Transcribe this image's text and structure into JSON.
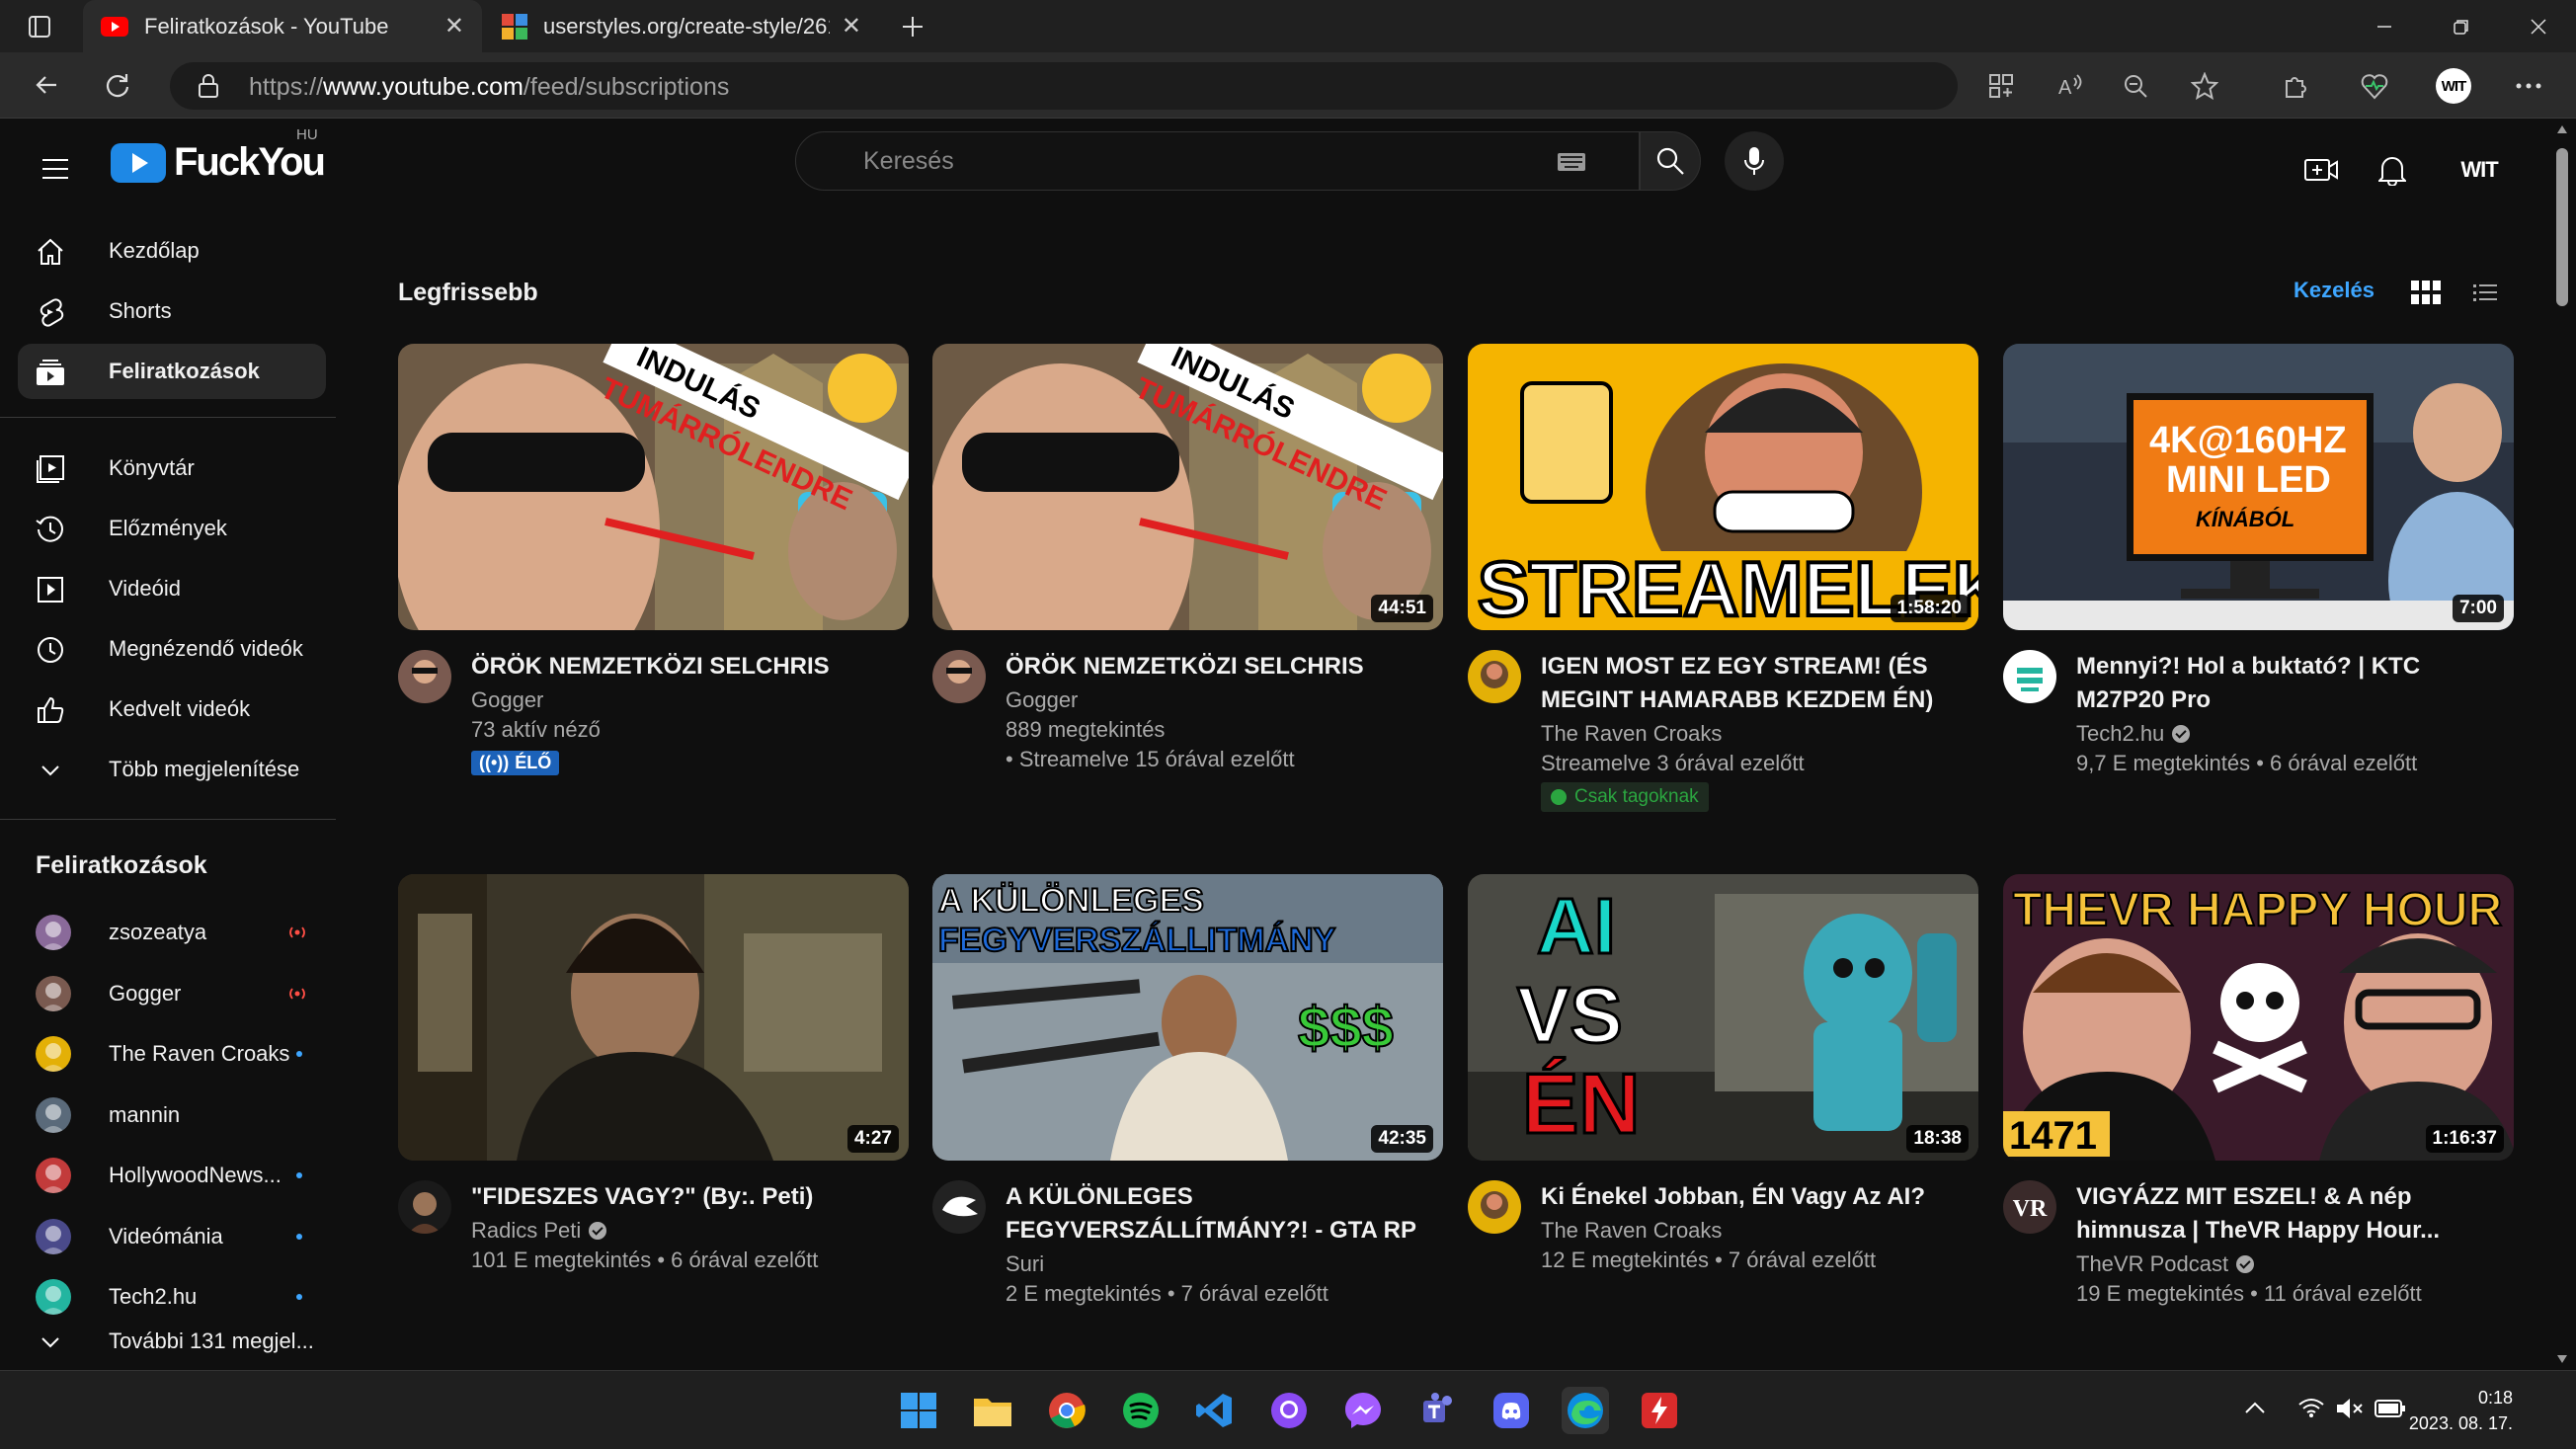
{
  "browser": {
    "tabs": [
      {
        "title": "Feliratkozások - YouTube",
        "active": true
      },
      {
        "title": "userstyles.org/create-style/26148",
        "active": false
      }
    ],
    "url_prefix": "https://",
    "url_domain": "www.youtube.com",
    "url_path": "/feed/subscriptions",
    "profile_label": "WIT"
  },
  "masthead": {
    "logo_text": "FuckYou",
    "region": "HU",
    "search_placeholder": "Keresés",
    "avatar_label": "WIT"
  },
  "sidebar": {
    "main": [
      {
        "label": "Kezdőlap",
        "icon": "home-icon"
      },
      {
        "label": "Shorts",
        "icon": "shorts-icon"
      },
      {
        "label": "Feliratkozások",
        "icon": "subscriptions-icon",
        "active": true
      }
    ],
    "library": [
      {
        "label": "Könyvtár",
        "icon": "library-icon"
      },
      {
        "label": "Előzmények",
        "icon": "history-icon"
      },
      {
        "label": "Videóid",
        "icon": "your-videos-icon"
      },
      {
        "label": "Megnézendő videók",
        "icon": "watch-later-icon"
      },
      {
        "label": "Kedvelt videók",
        "icon": "liked-icon"
      },
      {
        "label": "Több megjelenítése",
        "icon": "chevron-down-icon"
      }
    ],
    "subs_title": "Feliratkozások",
    "subscriptions": [
      {
        "name": "zsozeatya",
        "status": "live",
        "color": "#8a6a9a"
      },
      {
        "name": "Gogger",
        "status": "live",
        "color": "#7a5a50"
      },
      {
        "name": "The Raven Croaks",
        "status": "new",
        "color": "#e3b007"
      },
      {
        "name": "mannin",
        "status": "none",
        "color": "#5a6a7a"
      },
      {
        "name": "HollywoodNews...",
        "status": "new",
        "color": "#c23b3b"
      },
      {
        "name": "Videómánia",
        "status": "new",
        "color": "#4a4a8a"
      },
      {
        "name": "Tech2.hu",
        "status": "new",
        "color": "#23b5a0"
      }
    ],
    "more_subs": "További 131 megjel..."
  },
  "content": {
    "section_title": "Legfrissebb",
    "manage": "Kezelés",
    "videos": [
      {
        "title": "ÖRÖK NEMZETKÖZI SELCHRIS",
        "channel": "Gogger",
        "line2": "73 aktív néző",
        "line3": "",
        "duration": "",
        "badge": "live",
        "badge_text": "ÉLŐ",
        "verified": false,
        "avatar_color": "#7a5a50"
      },
      {
        "title": "ÖRÖK NEMZETKÖZI SELCHRIS",
        "channel": "Gogger",
        "line2": "889 megtekintés",
        "line3": "• Streamelve 15 órával ezelőtt",
        "duration": "44:51",
        "badge": "",
        "verified": false,
        "avatar_color": "#7a5a50"
      },
      {
        "title": "IGEN MOST EZ EGY STREAM! (ÉS MEGINT HAMARABB KEZDEM ÉN)",
        "channel": "The Raven Croaks",
        "line2": "Streamelve 3 órával ezelőtt",
        "line3": "",
        "duration": "1:58:20",
        "badge": "members",
        "badge_text": "Csak tagoknak",
        "verified": false,
        "avatar_color": "#e3b007"
      },
      {
        "title": "Mennyi?! Hol a buktató? | KTC M27P20 Pro",
        "channel": "Tech2.hu",
        "line2": "9,7 E megtekintés • 6 órával ezelőtt",
        "line3": "",
        "duration": "7:00",
        "badge": "",
        "verified": true,
        "avatar_color": "#23b5a0"
      },
      {
        "title": "\"FIDESZES VAGY?\" (By:. Peti)",
        "channel": "Radics Peti",
        "line2": "101 E megtekintés • 6 órával ezelőtt",
        "line3": "",
        "duration": "4:27",
        "badge": "",
        "verified": true,
        "avatar_color": "#5a3a2a"
      },
      {
        "title": "A KÜLÖNLEGES FEGYVERSZÁLLÍTMÁNY?! - GTA RP",
        "channel": "Suri",
        "line2": "2 E megtekintés • 7 órával ezelőtt",
        "line3": "",
        "duration": "42:35",
        "badge": "",
        "verified": false,
        "avatar_color": "#222"
      },
      {
        "title": "Ki Énekel Jobban, ÉN Vagy Az AI?",
        "channel": "The Raven Croaks",
        "line2": "12 E megtekintés • 7 órával ezelőtt",
        "line3": "",
        "duration": "18:38",
        "badge": "",
        "verified": false,
        "avatar_color": "#e3b007"
      },
      {
        "title": "VIGYÁZZ MIT ESZEL! & A nép himnusza | TheVR Happy Hour...",
        "channel": "TheVR Podcast",
        "line2": "19 E megtekintés • 11 órával ezelőtt",
        "line3": "",
        "duration": "1:16:37",
        "badge": "",
        "verified": true,
        "avatar_color": "#3a2a2a"
      }
    ],
    "thumb_text": {
      "t1_banner": "INDULÁS",
      "t1_banner2": "TUMÁRRÓLENDRE",
      "t3_text": "STREAMELEK",
      "t4_line1": "4K@160HZ",
      "t4_line2": "MINI LED",
      "t4_line3": "KÍNÁBÓL",
      "t6_line1": "A KÜLÖNLEGES",
      "t6_line2": "FEGYVERSZÁLLITMÁNY",
      "t6_money": "$$$",
      "t7_ai": "AI",
      "t7_vs": "VS",
      "t7_en": "ÉN",
      "t8_title": "THEVR HAPPY HOUR",
      "t8_num": "1471",
      "t8_avatar_text": "VR"
    }
  },
  "taskbar": {
    "time": "0:18",
    "date": "2023. 08. 17."
  }
}
